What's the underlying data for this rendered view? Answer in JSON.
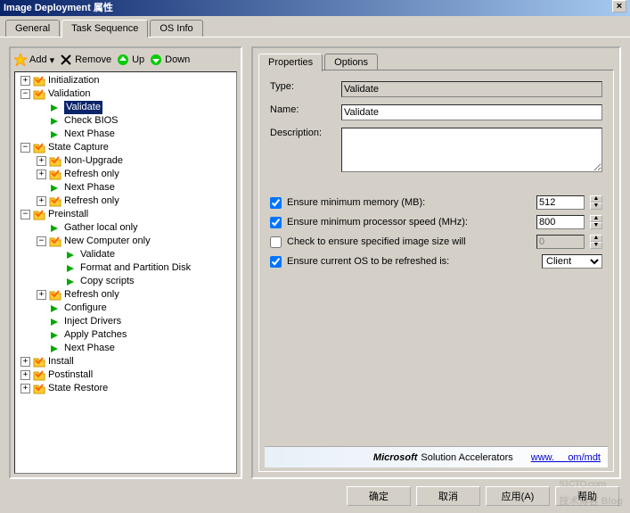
{
  "window": {
    "title": "Image Deployment 属性"
  },
  "mainTabs": [
    "General",
    "Task Sequence",
    "OS Info"
  ],
  "activeMainTab": 1,
  "toolbar": {
    "add": "Add",
    "remove": "Remove",
    "up": "Up",
    "down": "Down"
  },
  "tree": [
    {
      "d": 0,
      "exp": "+",
      "icon": "folder-check",
      "label": "Initialization"
    },
    {
      "d": 0,
      "exp": "-",
      "icon": "folder-check",
      "label": "Validation"
    },
    {
      "d": 1,
      "exp": "",
      "icon": "arrow",
      "label": "Validate",
      "selected": true
    },
    {
      "d": 1,
      "exp": "",
      "icon": "arrow",
      "label": "Check BIOS"
    },
    {
      "d": 1,
      "exp": "",
      "icon": "arrow",
      "label": "Next Phase"
    },
    {
      "d": 0,
      "exp": "-",
      "icon": "folder-check",
      "label": "State Capture"
    },
    {
      "d": 1,
      "exp": "+",
      "icon": "folder-check",
      "label": "Non-Upgrade"
    },
    {
      "d": 1,
      "exp": "+",
      "icon": "folder-check",
      "label": "Refresh only"
    },
    {
      "d": 1,
      "exp": "",
      "icon": "arrow",
      "label": "Next Phase"
    },
    {
      "d": 1,
      "exp": "+",
      "icon": "folder-check",
      "label": "Refresh only"
    },
    {
      "d": 0,
      "exp": "-",
      "icon": "folder-check",
      "label": "Preinstall"
    },
    {
      "d": 1,
      "exp": "",
      "icon": "arrow",
      "label": "Gather local only"
    },
    {
      "d": 1,
      "exp": "-",
      "icon": "folder-check",
      "label": "New Computer only"
    },
    {
      "d": 2,
      "exp": "",
      "icon": "arrow",
      "label": "Validate"
    },
    {
      "d": 2,
      "exp": "",
      "icon": "arrow",
      "label": "Format and Partition Disk"
    },
    {
      "d": 2,
      "exp": "",
      "icon": "arrow",
      "label": "Copy scripts"
    },
    {
      "d": 1,
      "exp": "+",
      "icon": "folder-check",
      "label": "Refresh only"
    },
    {
      "d": 1,
      "exp": "",
      "icon": "arrow",
      "label": "Configure"
    },
    {
      "d": 1,
      "exp": "",
      "icon": "arrow",
      "label": "Inject Drivers"
    },
    {
      "d": 1,
      "exp": "",
      "icon": "arrow",
      "label": "Apply Patches"
    },
    {
      "d": 1,
      "exp": "",
      "icon": "arrow",
      "label": "Next Phase"
    },
    {
      "d": 0,
      "exp": "+",
      "icon": "folder-check",
      "label": "Install"
    },
    {
      "d": 0,
      "exp": "+",
      "icon": "folder-check",
      "label": "Postinstall"
    },
    {
      "d": 0,
      "exp": "+",
      "icon": "folder-check",
      "label": "State Restore"
    }
  ],
  "subTabs": [
    "Properties",
    "Options"
  ],
  "activeSubTab": 0,
  "form": {
    "typeLabel": "Type:",
    "typeValue": "Validate",
    "nameLabel": "Name:",
    "nameValue": "Validate",
    "descLabel": "Description:",
    "descValue": ""
  },
  "checks": {
    "mem": {
      "checked": true,
      "label": "Ensure minimum memory (MB):",
      "value": "512"
    },
    "cpu": {
      "checked": true,
      "label": "Ensure minimum processor speed (MHz):",
      "value": "800"
    },
    "img": {
      "checked": false,
      "label": "Check to ensure specified image size will",
      "value": "0"
    },
    "os": {
      "checked": true,
      "label": "Ensure current OS to be refreshed is:",
      "value": "Client"
    }
  },
  "banner": {
    "brand": "Microsoft",
    "product": "Solution Accelerators",
    "linkPrefix": "www.",
    "linkSuffix": "om/mdt"
  },
  "buttons": {
    "ok": "确定",
    "cancel": "取消",
    "apply": "应用(A)",
    "help": "帮助"
  },
  "watermark": {
    "main": "51CTO.com",
    "sub": "技术博客 Blog"
  }
}
